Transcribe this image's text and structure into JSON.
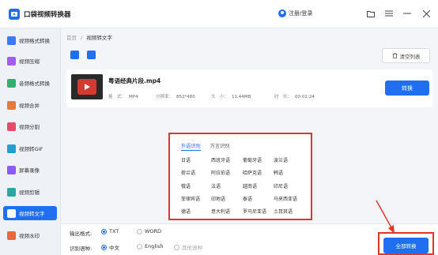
{
  "app": {
    "title": "口袋视频转换器",
    "user_label": "注册/登录"
  },
  "window_controls": [
    "folder-icon",
    "menu-icon",
    "minimize-icon",
    "close-icon"
  ],
  "sidebar": {
    "items": [
      {
        "label": "视频格式转换",
        "icon_color": "#3a7bf5",
        "active": false
      },
      {
        "label": "视频压缩",
        "icon_color": "#a45cf0",
        "active": false
      },
      {
        "label": "音频格式转换",
        "icon_color": "#2fb06f",
        "active": false
      },
      {
        "label": "视频合并",
        "icon_color": "#e8793a",
        "active": false
      },
      {
        "label": "视频分割",
        "icon_color": "#e84b6a",
        "active": false
      },
      {
        "label": "视频转GIF",
        "icon_color": "#1f9fd4",
        "active": false
      },
      {
        "label": "屏幕录像",
        "icon_color": "#8a5cf5",
        "active": false
      },
      {
        "label": "视频剪辑",
        "icon_color": "#28a8a0",
        "active": false
      },
      {
        "label": "视频转文字",
        "icon_color": "#ffffff",
        "active": true
      },
      {
        "label": "视频水印",
        "icon_color": "#e86a3a",
        "active": false
      }
    ]
  },
  "breadcrumb": {
    "home": "首页",
    "separator": "/",
    "current": "视频转文字"
  },
  "toolbar": {
    "clear_label": "清空列表"
  },
  "file": {
    "name": "粤语经典片段.mp4",
    "format_label": "格　式：",
    "format": "MP4",
    "resolution_label": "分辨率：",
    "resolution": "852*480",
    "size_label": "大　小：",
    "size": "11.44MB",
    "duration_label": "时　长：",
    "duration": "00:02:24",
    "convert_label": "转换"
  },
  "language_popup": {
    "tabs": [
      "外语识别",
      "方言识别"
    ],
    "active_tab": 0,
    "languages": [
      [
        "日语",
        "西班牙语",
        "葡萄牙语",
        "波兰语"
      ],
      [
        "荷兰语",
        "阿拉伯语",
        "哈萨克语",
        "韩语"
      ],
      [
        "俄语",
        "法语",
        "越南语",
        "印尼语"
      ],
      [
        "菲律宾语",
        "印地语",
        "泰语",
        "马来西亚语"
      ],
      [
        "德语",
        "意大利语",
        "罗马尼亚语",
        "土耳其语"
      ]
    ]
  },
  "bottom": {
    "output_format_label": "输出格式:",
    "output_formats": [
      {
        "label": "TXT",
        "selected": true
      },
      {
        "label": "WORD",
        "selected": false
      }
    ],
    "recognize_lang_label": "识别语种:",
    "recognize_langs": [
      {
        "label": "中文",
        "selected": true
      },
      {
        "label": "English",
        "selected": false
      },
      {
        "label": "其他语种",
        "selected": false
      }
    ],
    "convert_all_label": "全部转换"
  },
  "colors": {
    "accent": "#1f6ff0",
    "highlight": "#e0352b"
  }
}
